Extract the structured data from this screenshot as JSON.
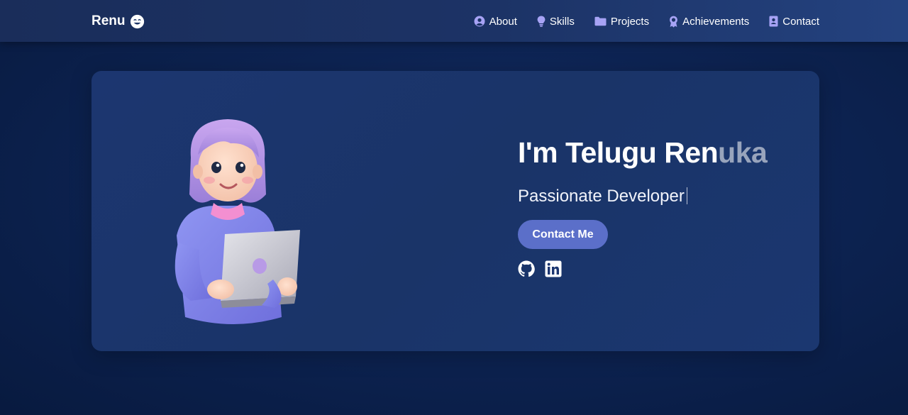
{
  "brand": {
    "name": "Renu",
    "emoji_icon": "smiley-icon"
  },
  "nav": {
    "items": [
      {
        "label": "About",
        "icon": "user-circle-icon"
      },
      {
        "label": "Skills",
        "icon": "lightbulb-icon"
      },
      {
        "label": "Projects",
        "icon": "folder-icon"
      },
      {
        "label": "Achievements",
        "icon": "award-icon"
      },
      {
        "label": "Contact",
        "icon": "address-book-icon"
      }
    ]
  },
  "hero": {
    "headline_main": "I'm Telugu Ren",
    "headline_fade": "uka",
    "subtitle": "Passionate Developer",
    "cta_label": "Contact Me",
    "socials": [
      {
        "icon": "github-icon"
      },
      {
        "icon": "linkedin-icon"
      }
    ]
  },
  "colors": {
    "background": "#0d2352",
    "navbar": "#1c3366",
    "card": "#1c3670",
    "accent": "#5b6fc9",
    "nav_icon": "#a7a3f5"
  }
}
